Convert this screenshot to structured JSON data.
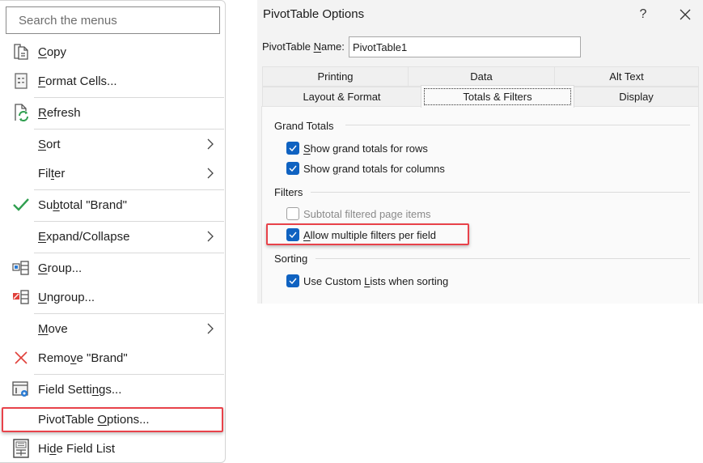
{
  "context_menu": {
    "search_placeholder": "Search the menus",
    "items": [
      {
        "id": "copy",
        "label": "Copy",
        "mnemonic": "C",
        "icon": "copy-icon"
      },
      {
        "id": "format-cells",
        "label": "Format Cells...",
        "mnemonic": "F",
        "icon": "format-cells-icon"
      },
      {
        "id": "refresh",
        "label": "Refresh",
        "mnemonic": "R",
        "icon": "refresh-icon"
      },
      {
        "id": "sort",
        "label": "Sort",
        "mnemonic": "S",
        "submenu": true
      },
      {
        "id": "filter",
        "label": "Filter",
        "mnemonic": "t",
        "submenu": true
      },
      {
        "id": "subtotal",
        "label": "Subtotal \"Brand\"",
        "mnemonic": "b",
        "icon": "checkmark-icon",
        "checked": true
      },
      {
        "id": "expand-collapse",
        "label": "Expand/Collapse",
        "mnemonic": "E",
        "submenu": true
      },
      {
        "id": "group",
        "label": "Group...",
        "mnemonic": "G",
        "icon": "group-icon"
      },
      {
        "id": "ungroup",
        "label": "Ungroup...",
        "mnemonic": "U",
        "icon": "ungroup-icon"
      },
      {
        "id": "move",
        "label": "Move",
        "mnemonic": "M",
        "submenu": true
      },
      {
        "id": "remove",
        "label": "Remove \"Brand\"",
        "mnemonic": "v",
        "icon": "remove-icon"
      },
      {
        "id": "field-settings",
        "label": "Field Settings...",
        "mnemonic": "n",
        "icon": "field-settings-icon"
      },
      {
        "id": "pivottable-options",
        "label": "PivotTable Options...",
        "mnemonic": "O",
        "highlighted": true
      },
      {
        "id": "hide-field-list",
        "label": "Hide Field List",
        "mnemonic": "d",
        "icon": "field-list-icon"
      }
    ]
  },
  "dialog": {
    "title": "PivotTable Options",
    "help_label": "?",
    "name_label": "PivotTable Name:",
    "name_label_mnemonic": "N",
    "name_value": "PivotTable1",
    "tabs_row_back": [
      "Printing",
      "Data",
      "Alt Text"
    ],
    "tabs_row_front": [
      "Layout & Format",
      "Totals & Filters",
      "Display"
    ],
    "active_tab": "Totals & Filters",
    "groups": {
      "grand_totals": {
        "title": "Grand Totals",
        "options": [
          {
            "label": "Show grand totals for rows",
            "checked": true,
            "mnemonic": "S"
          },
          {
            "label": "Show grand totals for columns",
            "checked": true,
            "mnemonic": "g"
          }
        ]
      },
      "filters": {
        "title": "Filters",
        "options": [
          {
            "label": "Subtotal filtered page items",
            "checked": false,
            "disabled": true
          },
          {
            "label": "Allow multiple filters per field",
            "checked": true,
            "mnemonic": "A",
            "highlighted": true
          }
        ]
      },
      "sorting": {
        "title": "Sorting",
        "options": [
          {
            "label": "Use Custom Lists when sorting",
            "checked": true,
            "mnemonic": "L"
          }
        ]
      }
    }
  },
  "colors": {
    "highlight_border": "#e8424a",
    "checkbox_blue": "#0f62c1",
    "check_green": "#2f9e4f",
    "remove_red": "#e0413b"
  }
}
